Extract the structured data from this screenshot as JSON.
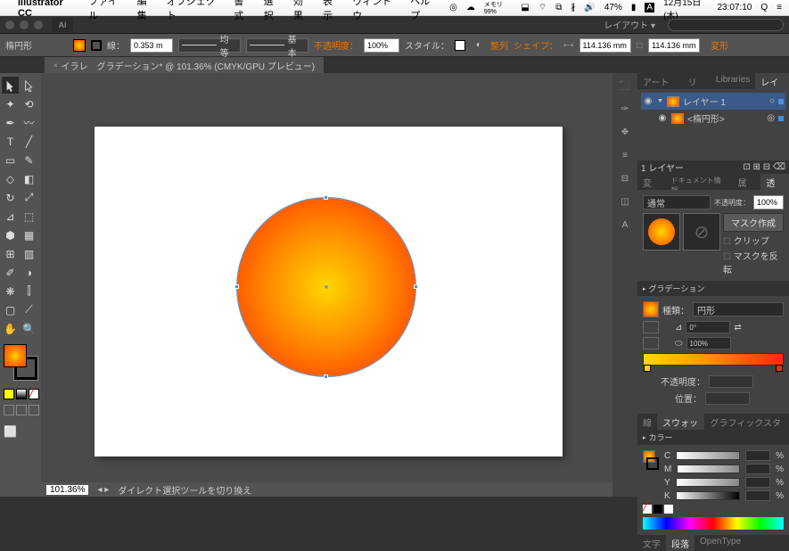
{
  "menubar": {
    "apple": "",
    "app": "Illustrator CC",
    "items": [
      "ファイル",
      "編集",
      "オブジェクト",
      "書式",
      "選択",
      "効果",
      "表示",
      "ウィンドウ",
      "ヘルプ"
    ],
    "battery": "47%",
    "date": "12月15日(木)",
    "time": "23:07:10",
    "memory": "メモリ 99%"
  },
  "titlebar": {
    "layout_label": "レイアウト ▾"
  },
  "controlbar": {
    "shape_label": "楕円形",
    "stroke_label": "線：",
    "stroke_width": "0.353 m",
    "stroke_style1": "均等",
    "stroke_style2": "基本",
    "opacity_label": "不透明度：",
    "opacity_val": "100%",
    "style_label": "スタイル：",
    "align_label": "整列",
    "shape_btn": "シェイプ：",
    "w_val": "114.136 mm",
    "h_val": "114.136 mm",
    "transform_label": "変形"
  },
  "tab": {
    "name": "イラレ　グラデーション* @ 101.36% (CMYK/GPU プレビュー)"
  },
  "statusbar": {
    "zoom": "101.36%",
    "tool_hint": "ダイレクト選択ツールを切り換え"
  },
  "layers_panel": {
    "tabs": [
      "アートボード",
      "リンク",
      "Libraries",
      "レイヤー"
    ],
    "layer1": "レイヤー 1",
    "shape": "<楕円形>",
    "footer": "1 レイヤー"
  },
  "appearance_panel": {
    "tabs": [
      "変形",
      "ドキュメント情報",
      "属性",
      "透明"
    ],
    "mode": "通常",
    "opacity_label": "不透明度：",
    "opacity": "100%",
    "mask_create": "マスク作成",
    "clip": "クリップ",
    "invert": "マスクを反転"
  },
  "gradient_panel": {
    "title": "グラデーション",
    "type_label": "種類：",
    "type": "円形",
    "angle": "0°",
    "ratio": "100%",
    "opacity_label": "不透明度：",
    "position_label": "位置："
  },
  "swatch_panel": {
    "tabs": [
      "線",
      "スウォッチ",
      "グラフィックスタイル"
    ]
  },
  "color_panel": {
    "title": "カラー",
    "channels": [
      "C",
      "M",
      "Y",
      "K"
    ],
    "pct": "%"
  },
  "bottom_tabs": {
    "tabs": [
      "文字",
      "段落",
      "OpenType"
    ]
  }
}
